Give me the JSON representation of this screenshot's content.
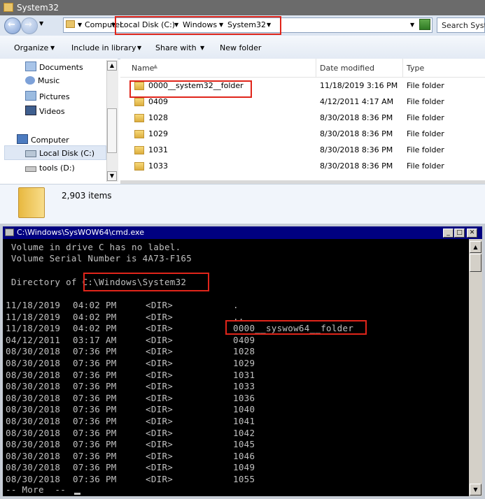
{
  "explorer": {
    "title": "System32",
    "breadcrumb": [
      "Computer",
      "Local Disk (C:)",
      "Windows",
      "System32"
    ],
    "search_placeholder": "Search Syste",
    "toolbar": [
      "Organize",
      "Include in library",
      "Share with",
      "New folder"
    ],
    "nav": [
      {
        "label": "Documents",
        "icon": "documents-icon"
      },
      {
        "label": "Music",
        "icon": "music-icon"
      },
      {
        "label": "Pictures",
        "icon": "pictures-icon"
      },
      {
        "label": "Videos",
        "icon": "videos-icon"
      },
      {
        "label": "Computer",
        "icon": "computer-icon"
      },
      {
        "label": "Local Disk (C:)",
        "icon": "drive-icon",
        "selected": true
      },
      {
        "label": "tools (D:)",
        "icon": "drive-icon"
      }
    ],
    "columns": {
      "name": "Name",
      "date": "Date modified",
      "type": "Type"
    },
    "files": [
      {
        "name": "0000__system32__folder",
        "date": "11/18/2019 3:16 PM",
        "type": "File folder",
        "highlighted": true
      },
      {
        "name": "0409",
        "date": "4/12/2011 4:17 AM",
        "type": "File folder"
      },
      {
        "name": "1028",
        "date": "8/30/2018 8:36 PM",
        "type": "File folder"
      },
      {
        "name": "1029",
        "date": "8/30/2018 8:36 PM",
        "type": "File folder"
      },
      {
        "name": "1031",
        "date": "8/30/2018 8:36 PM",
        "type": "File folder"
      },
      {
        "name": "1033",
        "date": "8/30/2018 8:36 PM",
        "type": "File folder"
      }
    ],
    "item_count": "2,903 items"
  },
  "cmd": {
    "title": "C:\\Windows\\SysWOW64\\cmd.exe",
    "volume_line": " Volume in drive C has no label.",
    "serial_line": " Volume Serial Number is 4A73-F165",
    "dir_prefix": " Directory of ",
    "dir_path": "C:\\Windows\\System32",
    "rows": [
      {
        "date": "11/18/2019",
        "time": "04:02 PM",
        "tag": "<DIR>",
        "name": "."
      },
      {
        "date": "11/18/2019",
        "time": "04:02 PM",
        "tag": "<DIR>",
        "name": ".."
      },
      {
        "date": "11/18/2019",
        "time": "04:02 PM",
        "tag": "<DIR>",
        "name": "0000__syswow64__folder",
        "highlighted": true
      },
      {
        "date": "04/12/2011",
        "time": "03:17 AM",
        "tag": "<DIR>",
        "name": "0409"
      },
      {
        "date": "08/30/2018",
        "time": "07:36 PM",
        "tag": "<DIR>",
        "name": "1028"
      },
      {
        "date": "08/30/2018",
        "time": "07:36 PM",
        "tag": "<DIR>",
        "name": "1029"
      },
      {
        "date": "08/30/2018",
        "time": "07:36 PM",
        "tag": "<DIR>",
        "name": "1031"
      },
      {
        "date": "08/30/2018",
        "time": "07:36 PM",
        "tag": "<DIR>",
        "name": "1033"
      },
      {
        "date": "08/30/2018",
        "time": "07:36 PM",
        "tag": "<DIR>",
        "name": "1036"
      },
      {
        "date": "08/30/2018",
        "time": "07:36 PM",
        "tag": "<DIR>",
        "name": "1040"
      },
      {
        "date": "08/30/2018",
        "time": "07:36 PM",
        "tag": "<DIR>",
        "name": "1041"
      },
      {
        "date": "08/30/2018",
        "time": "07:36 PM",
        "tag": "<DIR>",
        "name": "1042"
      },
      {
        "date": "08/30/2018",
        "time": "07:36 PM",
        "tag": "<DIR>",
        "name": "1045"
      },
      {
        "date": "08/30/2018",
        "time": "07:36 PM",
        "tag": "<DIR>",
        "name": "1046"
      },
      {
        "date": "08/30/2018",
        "time": "07:36 PM",
        "tag": "<DIR>",
        "name": "1049"
      },
      {
        "date": "08/30/2018",
        "time": "07:36 PM",
        "tag": "<DIR>",
        "name": "1055"
      }
    ],
    "more_prompt": "-- More  --",
    "highlight_color": "#e0251a"
  }
}
